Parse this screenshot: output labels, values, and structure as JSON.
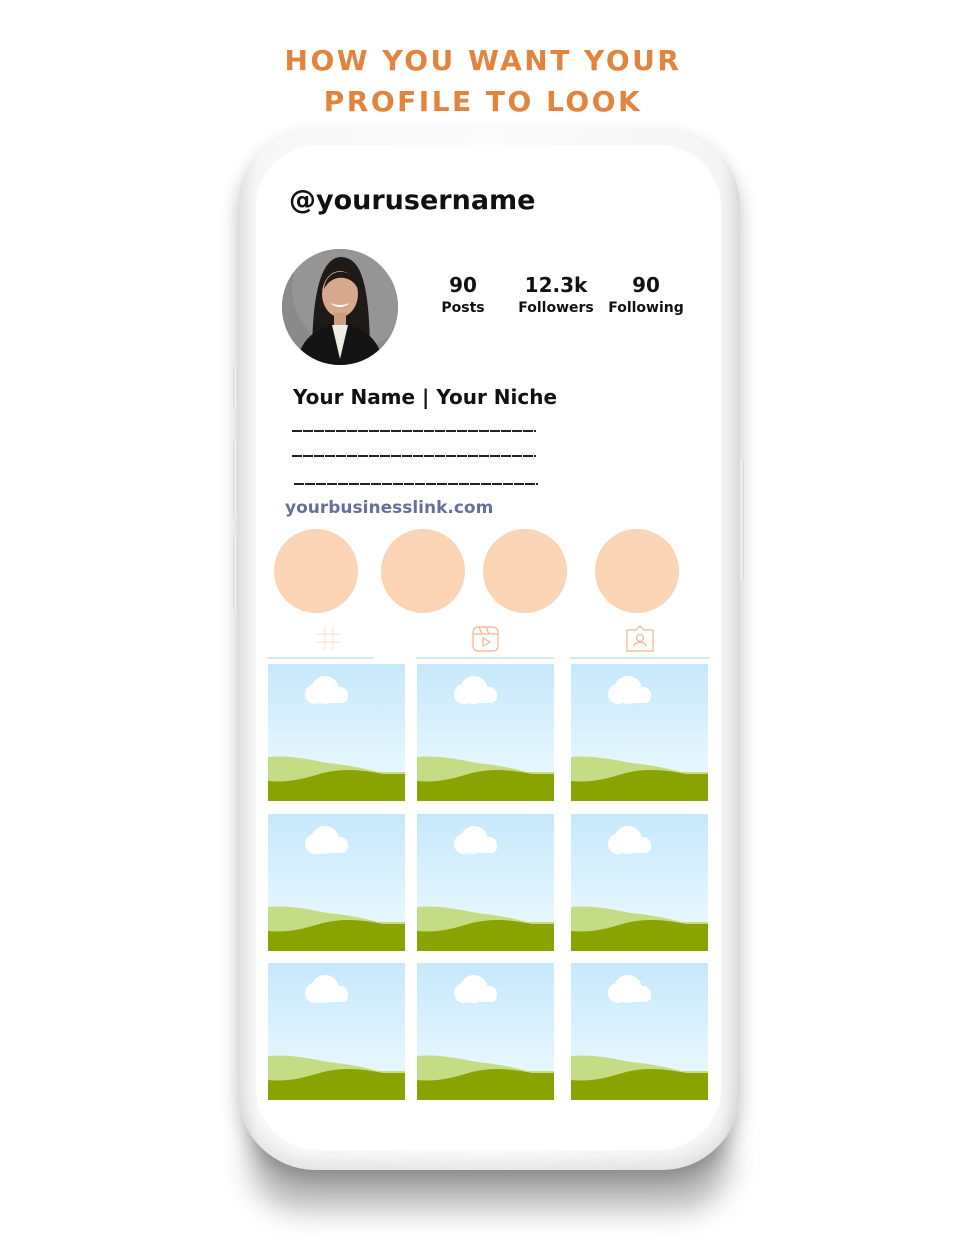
{
  "headline": {
    "line1": "HOW YOU WANT YOUR",
    "line2": "PROFILE TO LOOK",
    "color": "#e2843e"
  },
  "profile": {
    "username": "@yourusername",
    "avatar_icon": "profile-photo",
    "stats": [
      {
        "value": "90",
        "label": "Posts"
      },
      {
        "value": "12.3k",
        "label": "Followers"
      },
      {
        "value": "90",
        "label": "Following"
      }
    ],
    "bio": {
      "name_line": "Your Name | Your Niche",
      "lines": [
        "________________________",
        "________________________",
        "________________________"
      ]
    },
    "link": "yourbusinesslink.com",
    "link_color": "#6a6e9e"
  },
  "highlights": {
    "count": 4,
    "color": "#fbd4b5"
  },
  "tabs": [
    {
      "icon": "grid-icon",
      "name": "posts-tab"
    },
    {
      "icon": "reels-icon",
      "name": "reels-tab"
    },
    {
      "icon": "tagged-icon",
      "name": "tagged-tab"
    }
  ],
  "tab_icon_color": "#f2b58c",
  "posts": {
    "rows": 3,
    "columns": 3,
    "placeholder": "landscape-placeholder-image"
  }
}
